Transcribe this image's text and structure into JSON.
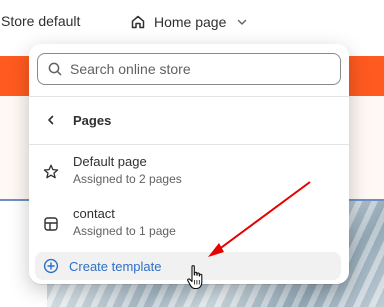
{
  "header": {
    "store_label": "Store default",
    "template_selector": {
      "icon": "home-icon",
      "label": "Home page",
      "chevron": "chevron-down-icon"
    }
  },
  "dropdown": {
    "search": {
      "placeholder": "Search online store",
      "value": ""
    },
    "section": {
      "back_icon": "chevron-left-icon",
      "title": "Pages"
    },
    "items": [
      {
        "icon": "star-icon",
        "name": "Default page",
        "subtitle": "Assigned to 2 pages"
      },
      {
        "icon": "layout-icon",
        "name": "contact",
        "subtitle": "Assigned to 1 page"
      }
    ],
    "create_button": {
      "icon": "plus-circle-icon",
      "label": "Create template"
    }
  },
  "colors": {
    "accent_blue": "#2c6ecb",
    "orange_band": "#ff5a1f",
    "annotation_arrow": "#e60000"
  }
}
